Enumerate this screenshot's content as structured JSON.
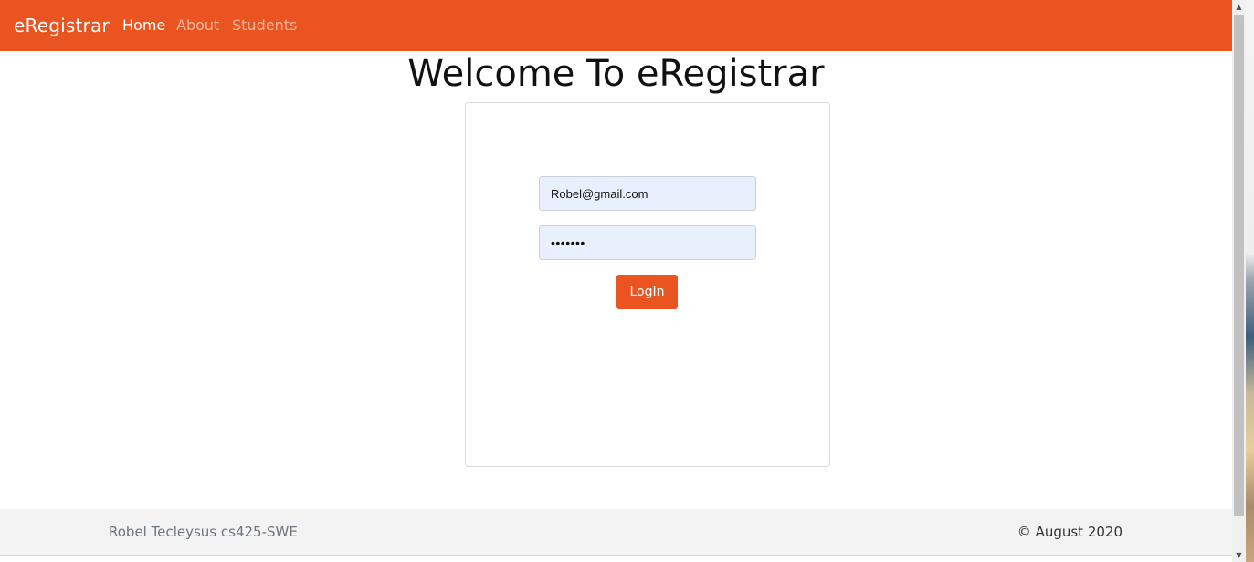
{
  "navbar": {
    "brand": "eRegistrar",
    "links": [
      "Home",
      "About",
      "Students"
    ],
    "color": "#e95420"
  },
  "main": {
    "title": "Welcome To eRegistrar"
  },
  "login": {
    "email_value": "Robel@gmail.com",
    "password_value": "•••••••",
    "button_label": "LogIn",
    "button_color": "#e95420",
    "input_bg": "#e8f0fe"
  },
  "footer": {
    "left_text": "Robel Tecleysus cs425-SWE",
    "right_text": "© August 2020"
  },
  "scrollbar": {
    "up_icon": "chevron-up-icon",
    "down_icon": "chevron-down-icon"
  }
}
